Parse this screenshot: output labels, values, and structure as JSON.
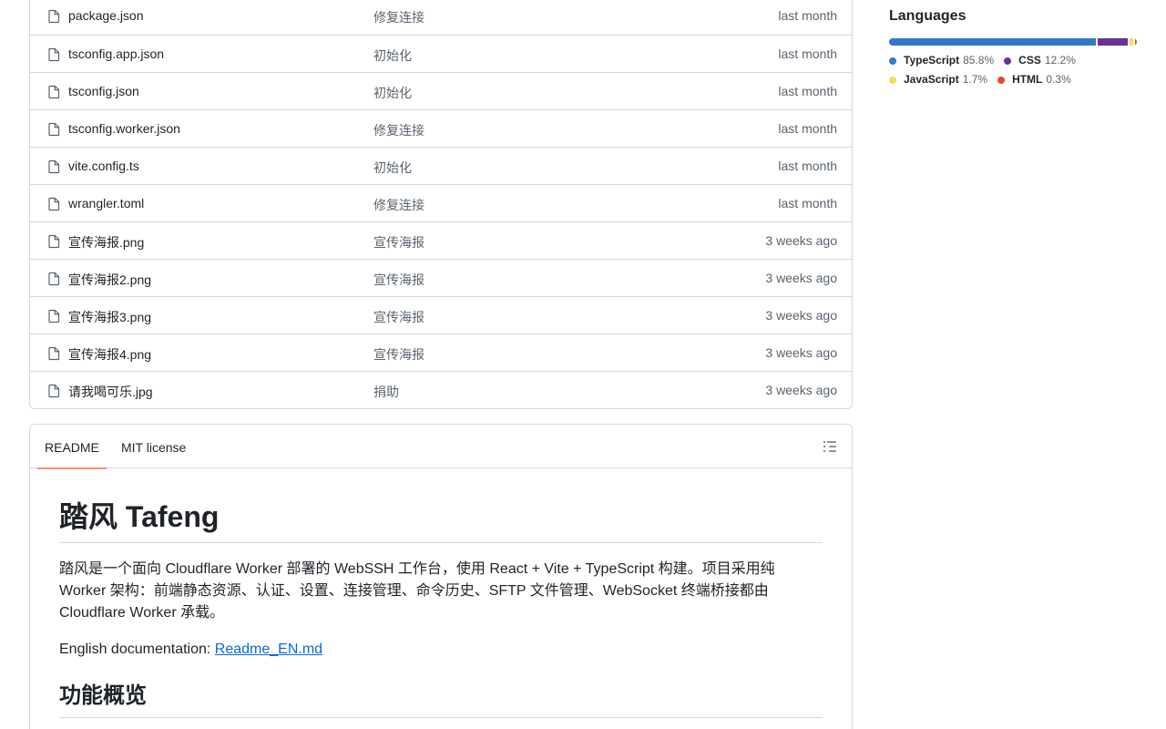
{
  "files": [
    {
      "name": "package.json",
      "commit": "修复连接",
      "date": "last month"
    },
    {
      "name": "tsconfig.app.json",
      "commit": "初始化",
      "date": "last month"
    },
    {
      "name": "tsconfig.json",
      "commit": "初始化",
      "date": "last month"
    },
    {
      "name": "tsconfig.worker.json",
      "commit": "修复连接",
      "date": "last month"
    },
    {
      "name": "vite.config.ts",
      "commit": "初始化",
      "date": "last month"
    },
    {
      "name": "wrangler.toml",
      "commit": "修复连接",
      "date": "last month"
    },
    {
      "name": "宣传海报.png",
      "commit": "宣传海报",
      "date": "3 weeks ago"
    },
    {
      "name": "宣传海报2.png",
      "commit": "宣传海报",
      "date": "3 weeks ago"
    },
    {
      "name": "宣传海报3.png",
      "commit": "宣传海报",
      "date": "3 weeks ago"
    },
    {
      "name": "宣传海报4.png",
      "commit": "宣传海报",
      "date": "3 weeks ago"
    },
    {
      "name": "请我喝可乐.jpg",
      "commit": "捐助",
      "date": "3 weeks ago"
    }
  ],
  "readme": {
    "tabs": {
      "readme": "README",
      "license": "MIT license"
    },
    "title": "踏风 Tafeng",
    "intro": "踏风是一个面向 Cloudflare Worker 部署的 WebSSH 工作台，使用 React + Vite + TypeScript 构建。项目采用纯 Worker 架构：前端静态资源、认证、设置、连接管理、命令历史、SFTP 文件管理、WebSocket 终端桥接都由 Cloudflare Worker 承载。",
    "english_doc_label": "English documentation: ",
    "english_doc_link": "Readme_EN.md",
    "section_heading": "功能概览"
  },
  "languages": {
    "title": "Languages",
    "items": [
      {
        "name": "TypeScript",
        "pct": "85.8%",
        "value": 85.8,
        "color": "#3178c6"
      },
      {
        "name": "CSS",
        "pct": "12.2%",
        "value": 12.2,
        "color": "#663399"
      },
      {
        "name": "JavaScript",
        "pct": "1.7%",
        "value": 1.7,
        "color": "#f1e05a"
      },
      {
        "name": "HTML",
        "pct": "0.3%",
        "value": 0.3,
        "color": "#e34c26"
      }
    ]
  }
}
